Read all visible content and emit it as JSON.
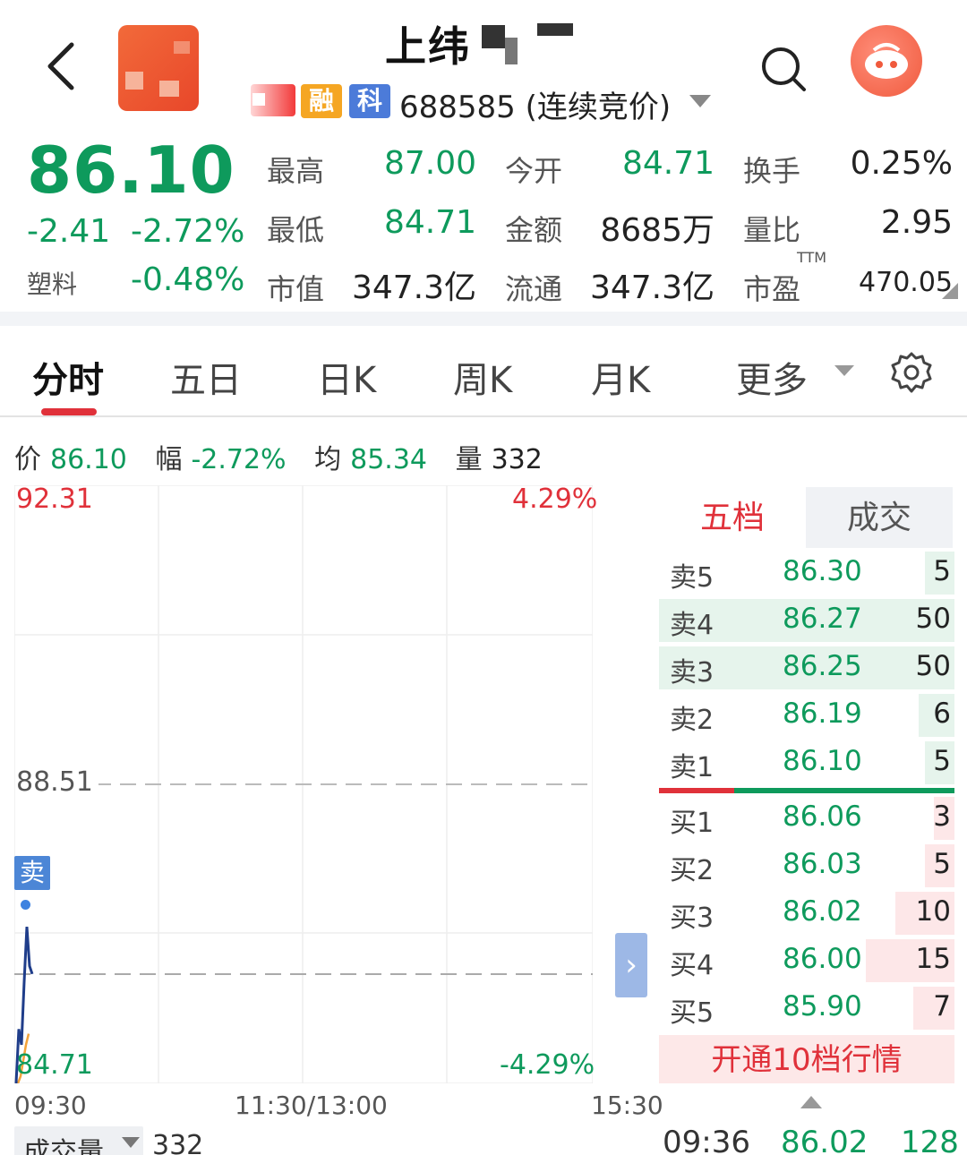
{
  "header": {
    "title": "上纬",
    "tags": [
      "融",
      "科"
    ],
    "code_line": "688585 (连续竞价)"
  },
  "quote": {
    "price": "86.10",
    "change": "-2.41",
    "change_pct": "-2.72%",
    "sector_name": "塑料",
    "sector_pct": "-0.48%",
    "grid": [
      {
        "label": "最高",
        "value": "87.00",
        "color": "green"
      },
      {
        "label": "今开",
        "value": "84.71",
        "color": "green"
      },
      {
        "label": "换手",
        "value": "0.25%",
        "color": "black"
      },
      {
        "label": "最低",
        "value": "84.71",
        "color": "green"
      },
      {
        "label": "金额",
        "value": "8685万",
        "color": "black"
      },
      {
        "label": "量比",
        "value": "2.95",
        "color": "black"
      },
      {
        "label": "市值",
        "value": "347.3亿",
        "color": "black"
      },
      {
        "label": "流通",
        "value": "347.3亿",
        "color": "black"
      },
      {
        "label": "市盈",
        "value": "470.05",
        "color": "black"
      }
    ],
    "ttm": "TTM"
  },
  "tabs": [
    "分时",
    "五日",
    "日K",
    "周K",
    "月K",
    "更多"
  ],
  "info": {
    "price_label": "价",
    "price": "86.10",
    "range_label": "幅",
    "range": "-2.72%",
    "avg_label": "均",
    "avg": "85.34",
    "vol_label": "量",
    "vol": "332"
  },
  "chart": {
    "y_top": "92.31",
    "y_mid": "88.51",
    "y_bottom": "84.71",
    "pct_top": "4.29%",
    "pct_bottom": "-4.29%",
    "times": [
      "09:30",
      "11:30/13:00",
      "15:30"
    ],
    "sell_marker": "卖",
    "expand": "›"
  },
  "chart_data": {
    "type": "line",
    "ylim": [
      84.71,
      92.31
    ],
    "reference": 88.51,
    "series": [
      {
        "values": [
          84.71,
          85.4,
          85.2,
          86.0,
          86.7,
          86.2,
          86.1
        ]
      },
      {
        "values": [
          84.71,
          84.8,
          85.0,
          85.2,
          85.34
        ]
      }
    ]
  },
  "order_book": {
    "tabs": [
      "五档",
      "成交"
    ],
    "asks": [
      {
        "label": "卖5",
        "price": "86.30",
        "vol": "5",
        "fill": 0.1
      },
      {
        "label": "卖4",
        "price": "86.27",
        "vol": "50",
        "fill": 1.0
      },
      {
        "label": "卖3",
        "price": "86.25",
        "vol": "50",
        "fill": 1.0
      },
      {
        "label": "卖2",
        "price": "86.19",
        "vol": "6",
        "fill": 0.12
      },
      {
        "label": "卖1",
        "price": "86.10",
        "vol": "5",
        "fill": 0.1
      }
    ],
    "bids": [
      {
        "label": "买1",
        "price": "86.06",
        "vol": "3",
        "fill": 0.07
      },
      {
        "label": "买2",
        "price": "86.03",
        "vol": "5",
        "fill": 0.1
      },
      {
        "label": "买3",
        "price": "86.02",
        "vol": "10",
        "fill": 0.2
      },
      {
        "label": "买4",
        "price": "86.00",
        "vol": "15",
        "fill": 0.3
      },
      {
        "label": "买5",
        "price": "85.90",
        "vol": "7",
        "fill": 0.14
      }
    ],
    "open_10": "开通10档行情",
    "last_trade": {
      "time": "09:36",
      "price": "86.02",
      "vol": "128"
    }
  },
  "volume": {
    "selector": "成交量",
    "value": "332"
  }
}
